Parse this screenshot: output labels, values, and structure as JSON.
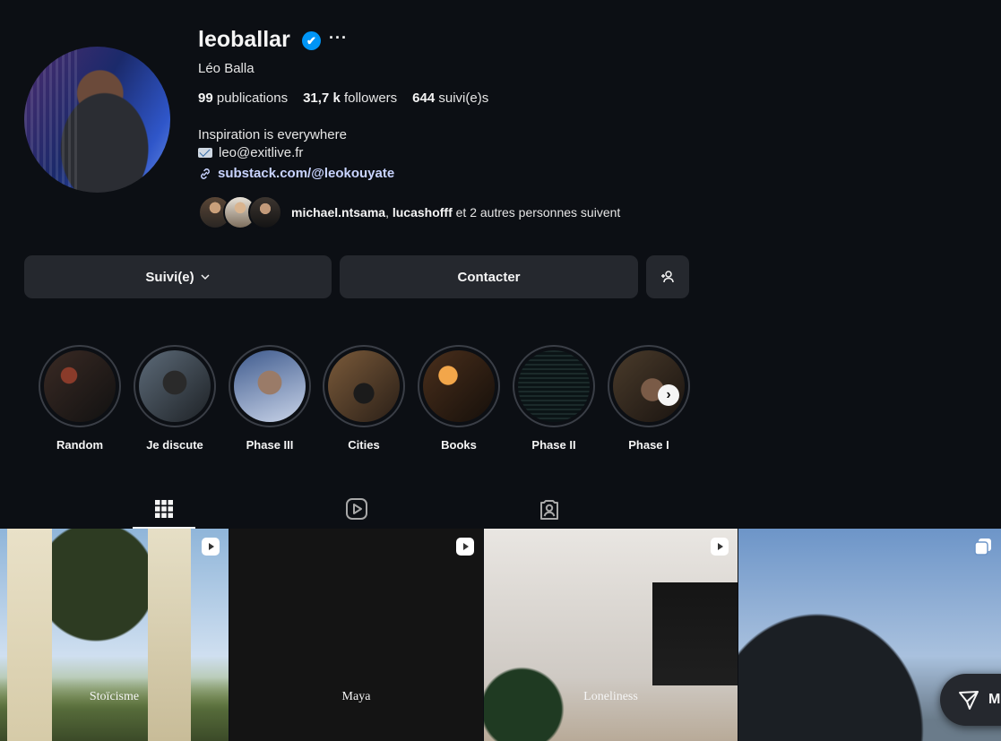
{
  "profile": {
    "username": "leoballar",
    "verified_mark": "✔",
    "more_label": "···",
    "full_name": "Léo Balla",
    "stats": {
      "posts_count": "99",
      "posts_label": "publications",
      "followers_count": "31,7 k",
      "followers_label": "followers",
      "following_count": "644",
      "following_label": "suivi(e)s"
    },
    "bio_line1": "Inspiration is everywhere",
    "bio_email": "leo@exitlive.fr",
    "link_text": "substack.com/@leokouyate",
    "followed_by": {
      "user1": "michael.ntsama",
      "separator": ", ",
      "user2": "lucashofff",
      "rest": " et 2 autres personnes suivent"
    }
  },
  "actions": {
    "following_button": "Suivi(e)",
    "contact_button": "Contacter"
  },
  "highlights": [
    {
      "label": "Random"
    },
    {
      "label": "Je discute"
    },
    {
      "label": "Phase III"
    },
    {
      "label": "Cities"
    },
    {
      "label": "Books"
    },
    {
      "label": "Phase II"
    },
    {
      "label": "Phase I"
    }
  ],
  "posts": [
    {
      "caption": "Stoïcisme",
      "type": "reel"
    },
    {
      "caption": "Maya",
      "type": "reel"
    },
    {
      "caption": "Loneliness",
      "type": "reel"
    },
    {
      "caption": "",
      "type": "carousel"
    }
  ],
  "message_button": {
    "label": "M"
  },
  "colors": {
    "background": "#0c0f14",
    "button": "#25282e",
    "verified": "#0095f6",
    "link": "#c9d4ff"
  }
}
